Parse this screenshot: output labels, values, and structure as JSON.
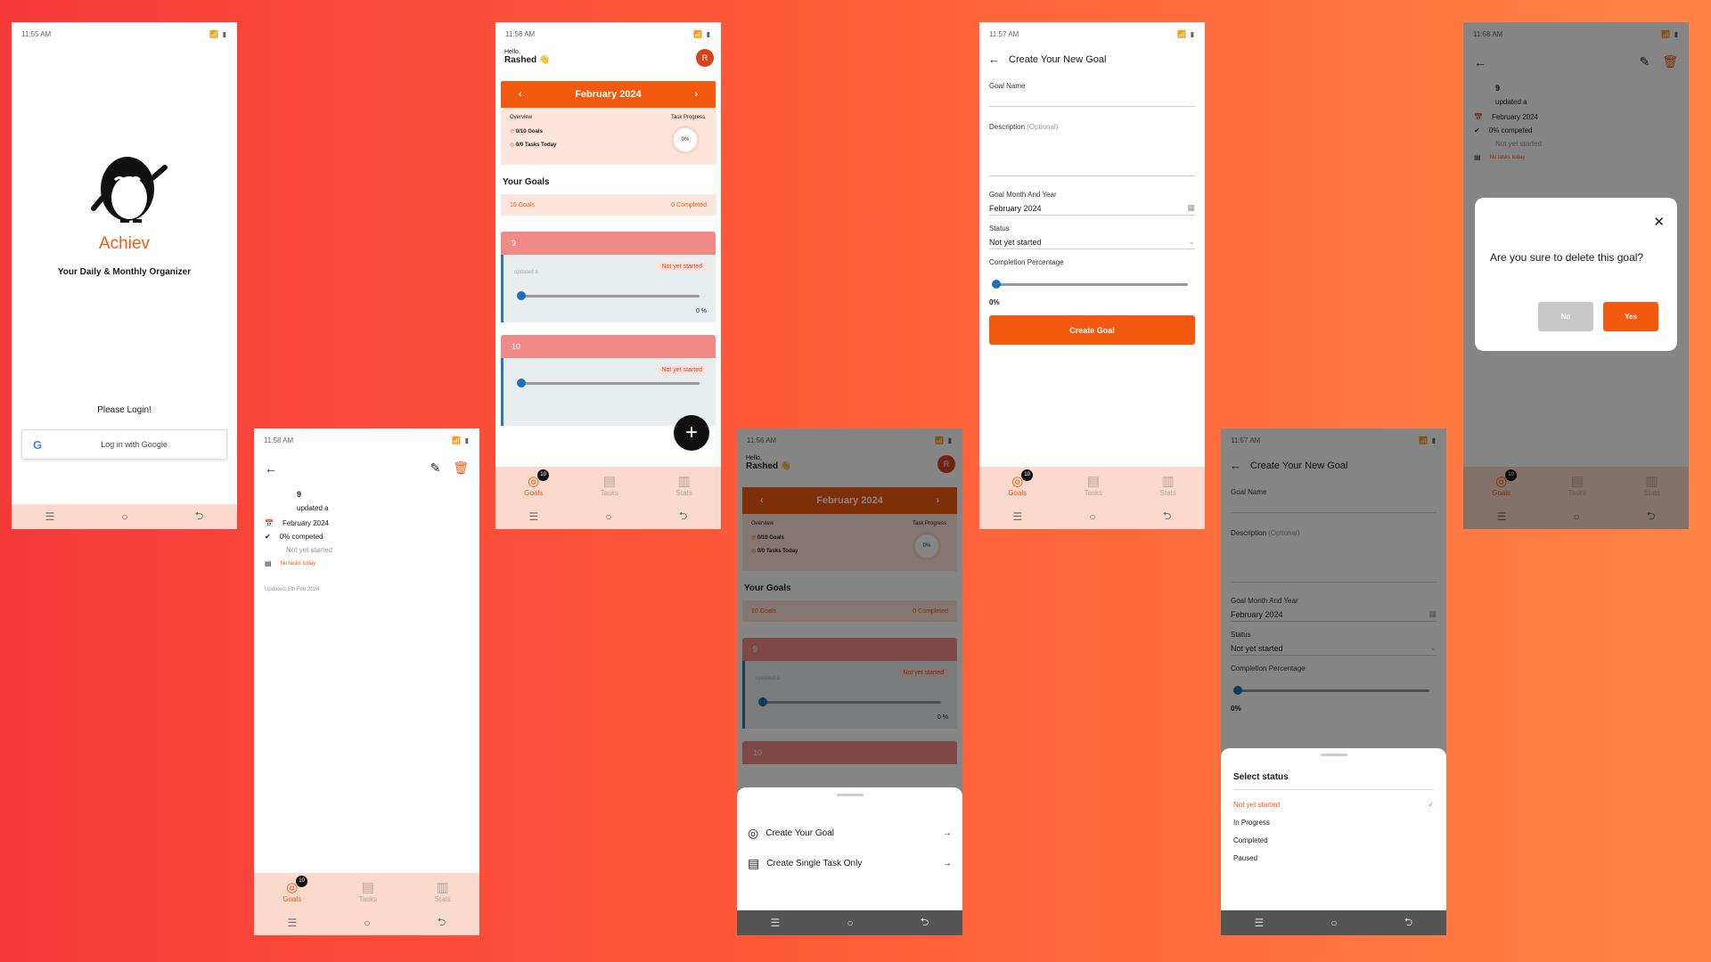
{
  "status_times": [
    "11:55 AM",
    "11:58 AM",
    "11:56 AM",
    "11:56 AM",
    "11:57 AM",
    "11:57 AM",
    "11:58 AM"
  ],
  "nav_glyphs": {
    "menu": "☰",
    "home": "○",
    "back": "⮌"
  },
  "tabs": {
    "goals": "Goals",
    "tasks": "Tasks",
    "stats": "Stats",
    "badge": "10"
  },
  "login": {
    "app_name": "Achiev",
    "tagline": "Your Daily & Monthly Organizer",
    "prompt": "Please Login!",
    "google_button": "Log in with Google"
  },
  "detail": {
    "name": "9",
    "description": "updated a",
    "month": "February 2024",
    "progress": "0% competed",
    "status": "Not yet started",
    "tasks": "No tasks today",
    "updated": "Updated: 5th Feb 2024"
  },
  "home": {
    "hello": "Hello,",
    "user": "Rashed",
    "wave": "👋",
    "avatar": "R",
    "month": "February 2024",
    "overview": "Overview",
    "task_progress": "Task Progress",
    "goals_stat": "0/10 Goals",
    "tasks_stat": "0/0 Tasks Today",
    "progress_value": "0%",
    "your_goals": "Your Goals",
    "goals_count": "10 Goals",
    "completed_count": "0 Completed",
    "goals": [
      {
        "name": "9",
        "desc": "updated a",
        "status": "Not yet started",
        "percent": "0 %"
      },
      {
        "name": "10",
        "desc": "",
        "status": "Not yet started",
        "percent": ""
      }
    ],
    "fab": "+"
  },
  "sheet": {
    "create_goal": "Create Your Goal",
    "create_task": "Create Single Task Only"
  },
  "form": {
    "title": "Create Your New Goal",
    "goal_name_label": "Goal Name",
    "description_label": "Description",
    "optional": "(Optional)",
    "month_label": "Goal Month And Year",
    "month_value": "February 2024",
    "status_label": "Status",
    "status_value": "Not yet started",
    "completion_label": "Completion Percentage",
    "completion_value": "0%",
    "completion_fraction": 0,
    "create_button": "Create Goal"
  },
  "status_picker": {
    "title": "Select status",
    "options": [
      "Not yet started",
      "In Progress",
      "Completed",
      "Paused"
    ]
  },
  "delete_dialog": {
    "question": "Are you sure to delete this goal?",
    "no": "No",
    "yes": "Yes"
  },
  "colors": {
    "accent": "#f15a0f",
    "tab_bg": "#fbd9cc",
    "card_red": "#ef8a85",
    "slider_blue": "#1e6fb5"
  }
}
